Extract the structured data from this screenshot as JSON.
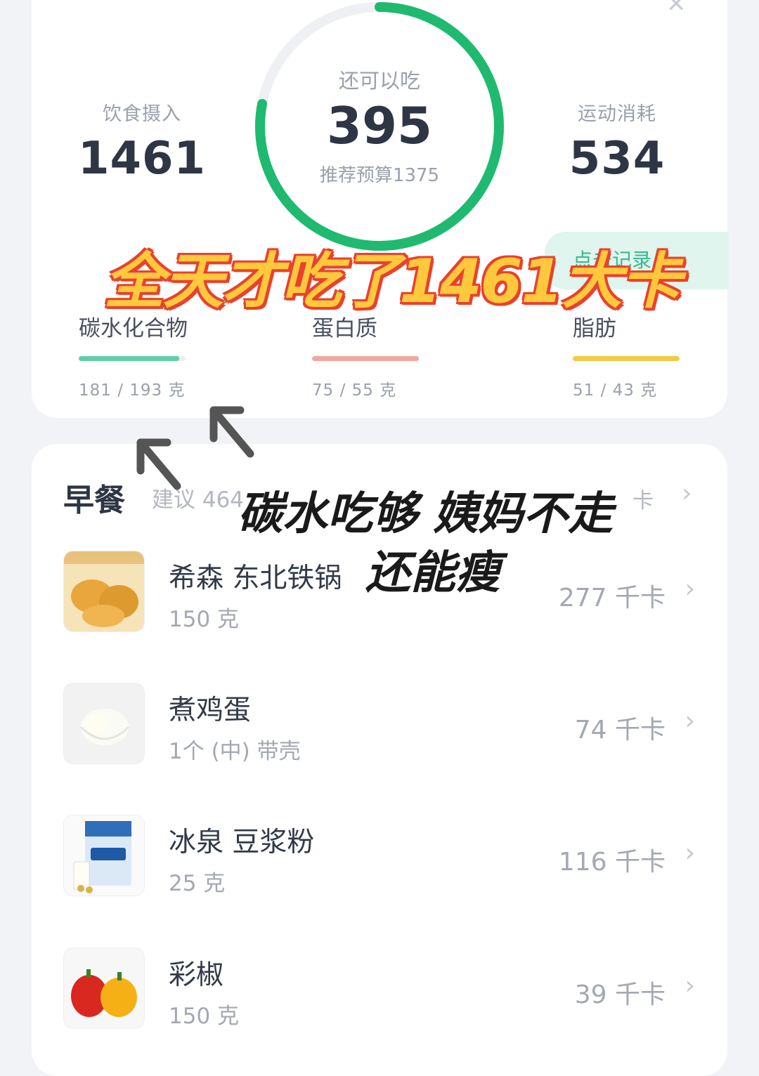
{
  "summary": {
    "intake_label": "饮食摄入",
    "intake_value": "1461",
    "burn_label": "运动消耗",
    "burn_value": "534",
    "remaining_label": "还可以吃",
    "remaining_value": "395",
    "budget_text": "推荐预算1375",
    "ring_progress": 0.78,
    "ring_color": "#1fba6f",
    "record_tab_text": "点击记录"
  },
  "macros": [
    {
      "name": "碳水化合物",
      "value": "181 / 193 克",
      "fill": 0.94,
      "color": "#5ed0a3"
    },
    {
      "name": "蛋白质",
      "value": "75 / 55 克",
      "fill": 1.0,
      "color": "#f4a6a0"
    },
    {
      "name": "脂肪",
      "value": "51 / 43 克",
      "fill": 1.0,
      "color": "#f6c944"
    }
  ],
  "overlay": {
    "title": "全天才吃了1461大卡",
    "line1": "碳水吃够 姨妈不走",
    "line2": "还能瘦"
  },
  "meal": {
    "title": "早餐",
    "hint": "建议 464",
    "total": "卡",
    "items": [
      {
        "name": "希森 东北铁锅",
        "qty": "150 克",
        "kcal": "277 千卡",
        "icon": "bread-thumb"
      },
      {
        "name": "煮鸡蛋",
        "qty": "1个 (中) 带壳",
        "kcal": "74 千卡",
        "icon": "egg-thumb"
      },
      {
        "name": "冰泉 豆浆粉",
        "qty": "25 克",
        "kcal": "116 千卡",
        "icon": "soy-milk-thumb"
      },
      {
        "name": "彩椒",
        "qty": "150 克",
        "kcal": "39 千卡",
        "icon": "pepper-thumb"
      }
    ]
  },
  "chevron": "›"
}
